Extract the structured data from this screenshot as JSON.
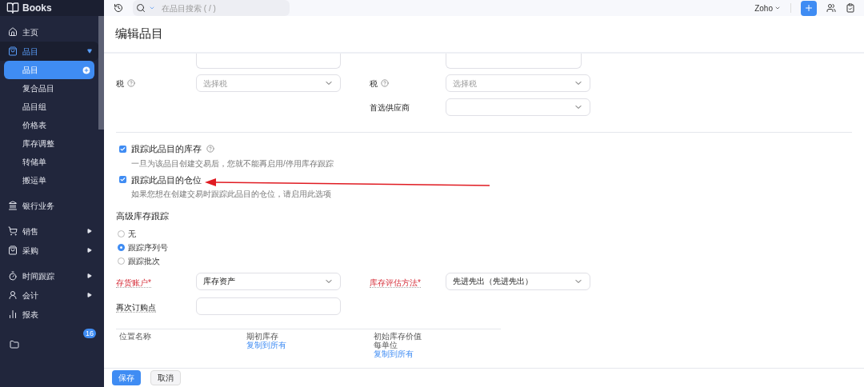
{
  "app": {
    "name": "Books"
  },
  "search": {
    "placeholder": "在品目搜索 ( / )"
  },
  "org": {
    "label": "Zoho"
  },
  "sidebar": {
    "items": [
      {
        "label": "主页",
        "kind": "link"
      },
      {
        "label": "品目",
        "kind": "group",
        "expanded": true,
        "children": [
          {
            "label": "品目",
            "selected": true
          },
          {
            "label": "复合品目",
            "selected": false
          },
          {
            "label": "品目组",
            "selected": false
          },
          {
            "label": "价格表",
            "selected": false
          },
          {
            "label": "库存调整",
            "selected": false
          },
          {
            "label": "转储单",
            "selected": false
          },
          {
            "label": "搬运单",
            "selected": false
          }
        ]
      },
      {
        "label": "银行业务",
        "kind": "link"
      },
      {
        "label": "销售",
        "kind": "group",
        "expanded": false
      },
      {
        "label": "采购",
        "kind": "group",
        "expanded": false
      },
      {
        "label": "时间跟踪",
        "kind": "group",
        "expanded": false
      },
      {
        "label": "会计",
        "kind": "group",
        "expanded": false
      },
      {
        "label": "报表",
        "kind": "link"
      }
    ],
    "badge": "16"
  },
  "page_title": "编辑品目",
  "tax_row": {
    "left": {
      "label": "税",
      "placeholder": "选择税"
    },
    "right": {
      "label": "税",
      "placeholder": "选择税"
    }
  },
  "vendor": {
    "label": "首选供应商"
  },
  "checkboxes": [
    {
      "label": "跟踪此品目的库存",
      "help": true,
      "checked": true,
      "hint": "一旦为该品目创建交易后，您就不能再启用/停用库存跟踪"
    },
    {
      "label": "跟踪此品目的仓位",
      "help": false,
      "checked": true,
      "hint": "如果您想在创建交易时跟踪此品目的仓位，请启用此选项"
    }
  ],
  "advanced": {
    "title": "高级库存跟踪",
    "options": [
      {
        "label": "无",
        "selected": false
      },
      {
        "label": "跟踪序列号",
        "selected": true
      },
      {
        "label": "跟踪批次",
        "selected": false
      }
    ]
  },
  "account": {
    "label": "存货账户*",
    "required": true,
    "value": "库存资产"
  },
  "valuation": {
    "label": "库存评估方法*",
    "required": true,
    "value": "先进先出（先进先出）"
  },
  "reorder": {
    "label": "再次订购点",
    "required": false
  },
  "table": {
    "columns": [
      {
        "lines": [
          "位置名称"
        ]
      },
      {
        "lines": [
          "期初库存"
        ],
        "link": "复制到所有"
      },
      {
        "lines": [
          "初始库存价值",
          "每单位"
        ],
        "link": "复制到所有"
      }
    ]
  },
  "buttons": [
    {
      "label": "保存",
      "kind": "primary"
    },
    {
      "label": "取消",
      "kind": "secondary"
    }
  ]
}
